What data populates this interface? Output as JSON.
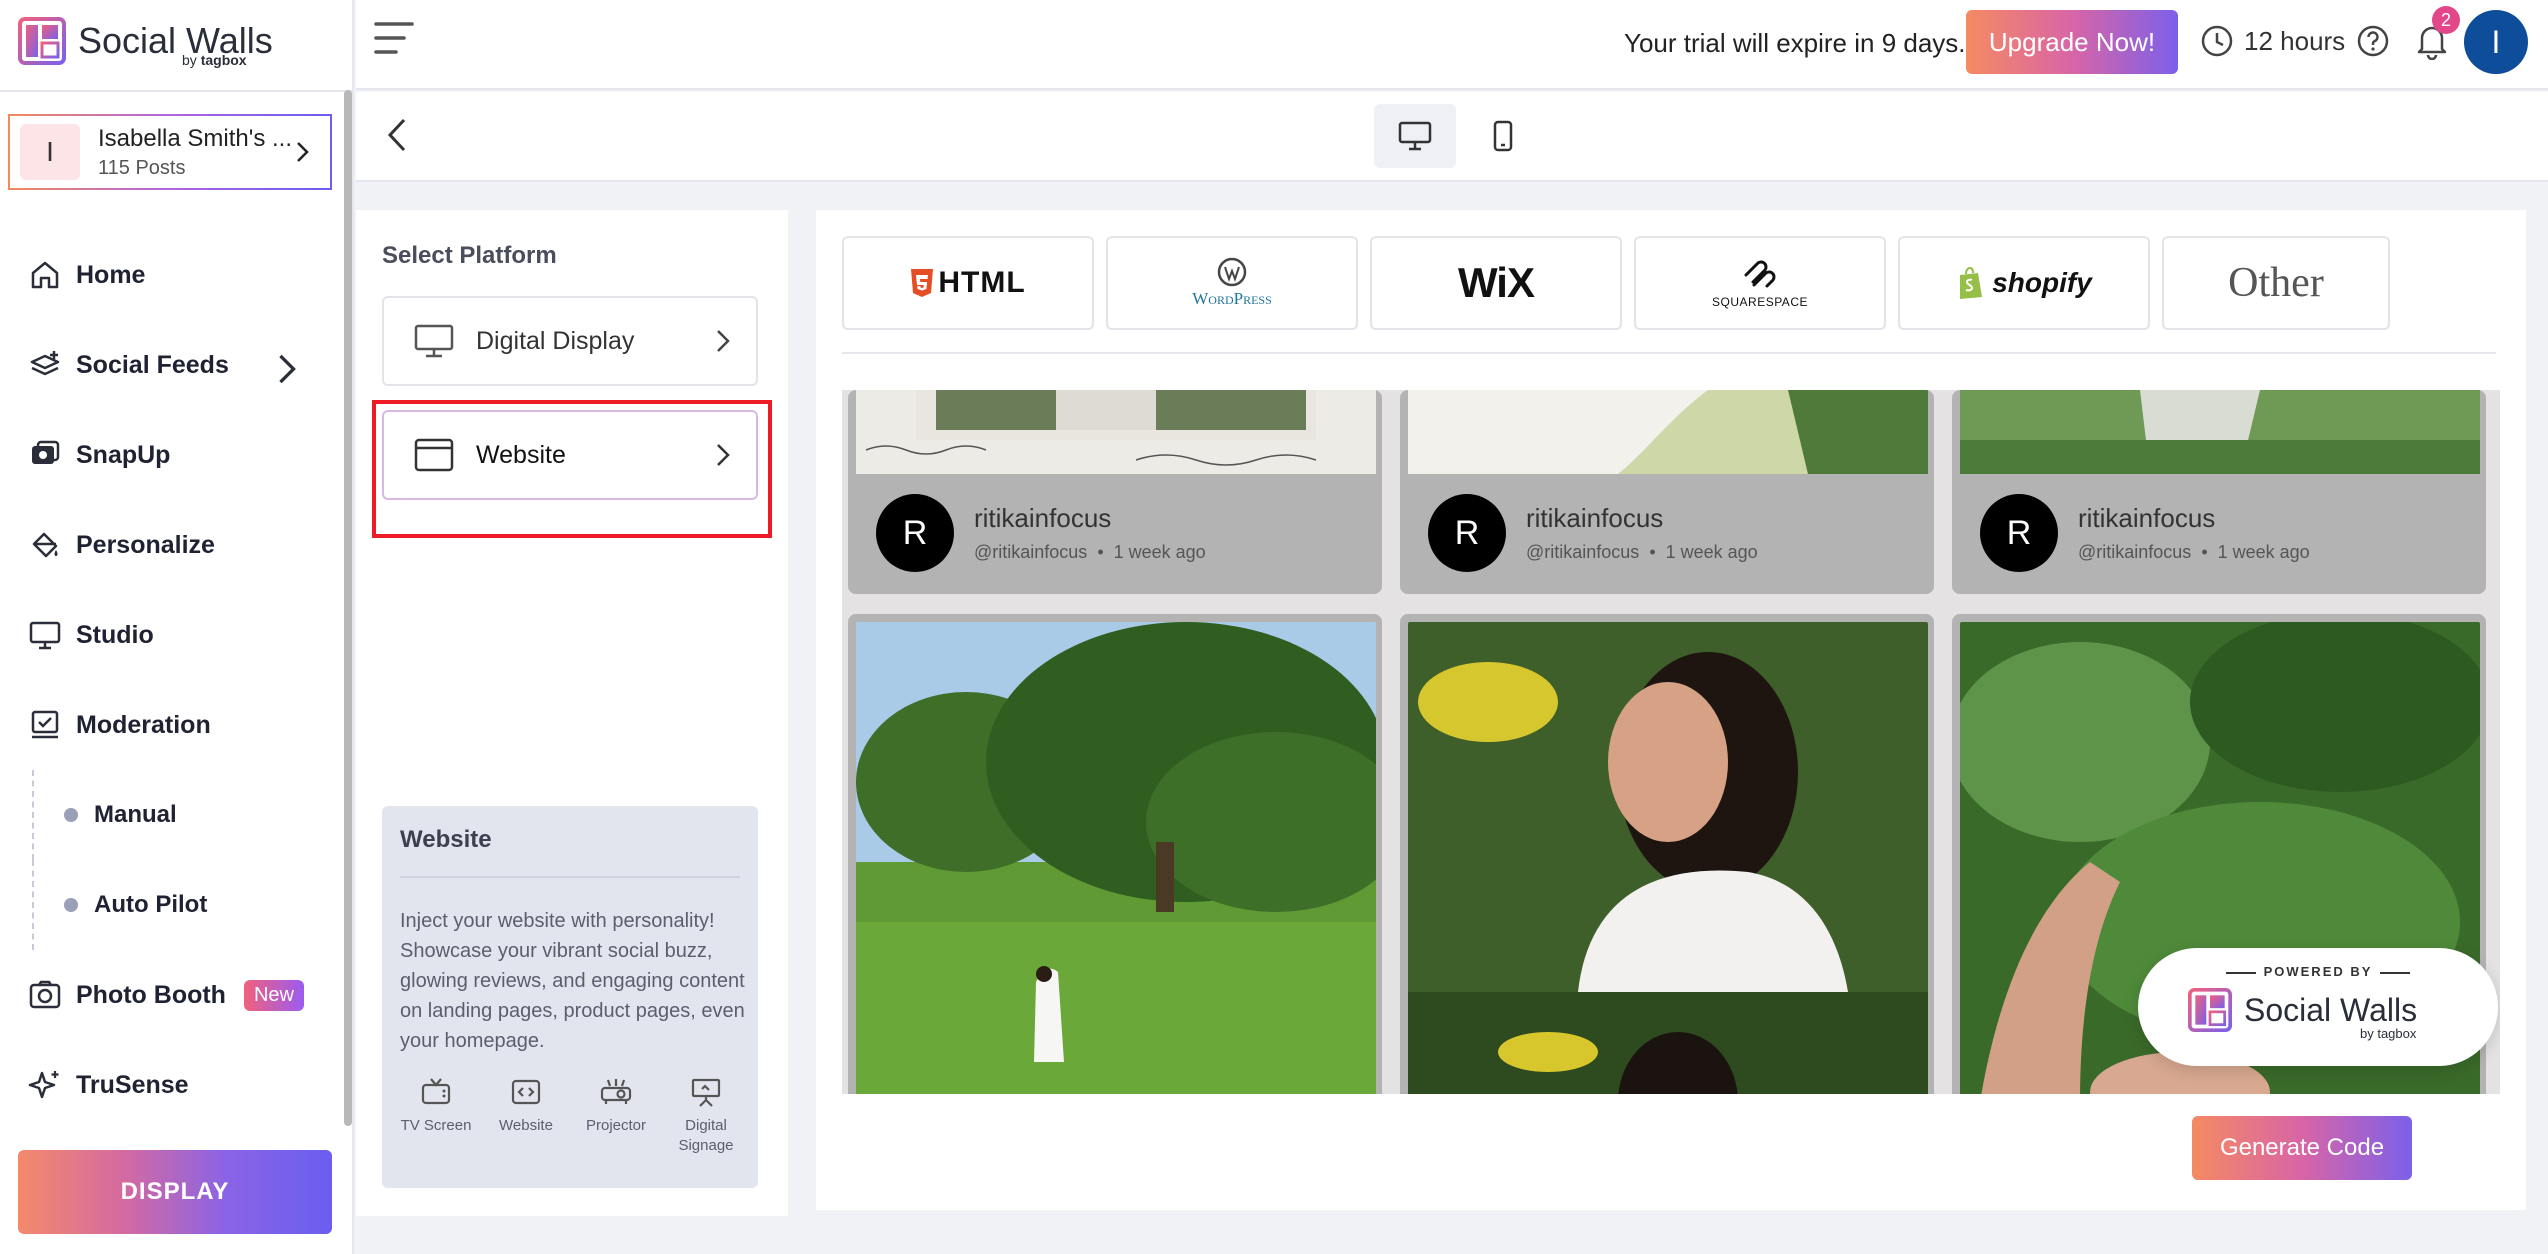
{
  "app": {
    "logo_title": "Social Walls",
    "logo_sub_prefix": "by",
    "logo_sub_brand": "tagbox"
  },
  "account": {
    "initial": "I",
    "name": "Isabella Smith's ...",
    "posts": "115 Posts"
  },
  "nav": {
    "home": "Home",
    "social_feeds": "Social Feeds",
    "snapup": "SnapUp",
    "personalize": "Personalize",
    "studio": "Studio",
    "moderation": "Moderation",
    "manual": "Manual",
    "auto_pilot": "Auto Pilot",
    "photo_booth": "Photo Booth",
    "photo_booth_badge": "New",
    "trusense": "TruSense",
    "display_button": "DISPLAY"
  },
  "header": {
    "trial_text": "Your trial will expire in 9 days.",
    "upgrade_label": "Upgrade Now!",
    "time_label": "12 hours",
    "notification_count": "2",
    "user_initial": "I"
  },
  "platform": {
    "title": "Select Platform",
    "options": [
      {
        "label": "Digital Display"
      },
      {
        "label": "Website"
      }
    ],
    "selected": "Website"
  },
  "info": {
    "title": "Website",
    "description": "Inject your website with personality! Showcase your vibrant social buzz, glowing reviews, and engaging content on landing pages, product pages, even your homepage.",
    "icons": [
      {
        "label": "TV Screen",
        "icon": "tv-icon"
      },
      {
        "label": "Website",
        "icon": "code-window-icon"
      },
      {
        "label": "Projector",
        "icon": "projector-icon"
      },
      {
        "label": "Digital Signage",
        "icon": "signage-icon"
      }
    ]
  },
  "cms": {
    "html": "HTML",
    "wordpress": "WordPress",
    "wix": "WiX",
    "squarespace": "SQUARESPACE",
    "shopify": "shopify",
    "other": "Other"
  },
  "posts": [
    {
      "initial": "R",
      "name": "ritikainfocus",
      "handle": "@ritikainfocus",
      "time": "1 week ago"
    },
    {
      "initial": "R",
      "name": "ritikainfocus",
      "handle": "@ritikainfocus",
      "time": "1 week ago"
    },
    {
      "initial": "R",
      "name": "ritikainfocus",
      "handle": "@ritikainfocus",
      "time": "1 week ago"
    }
  ],
  "powered": {
    "label": "POWERED BY",
    "title": "Social Walls",
    "sub": "by tagbox"
  },
  "generate_code_label": "Generate Code",
  "colors": {
    "accent_gradient_start": "#f58a62",
    "accent_gradient_end": "#7c60ea",
    "highlight_red": "#ee1c24",
    "avatar_blue": "#0e4d9a"
  }
}
